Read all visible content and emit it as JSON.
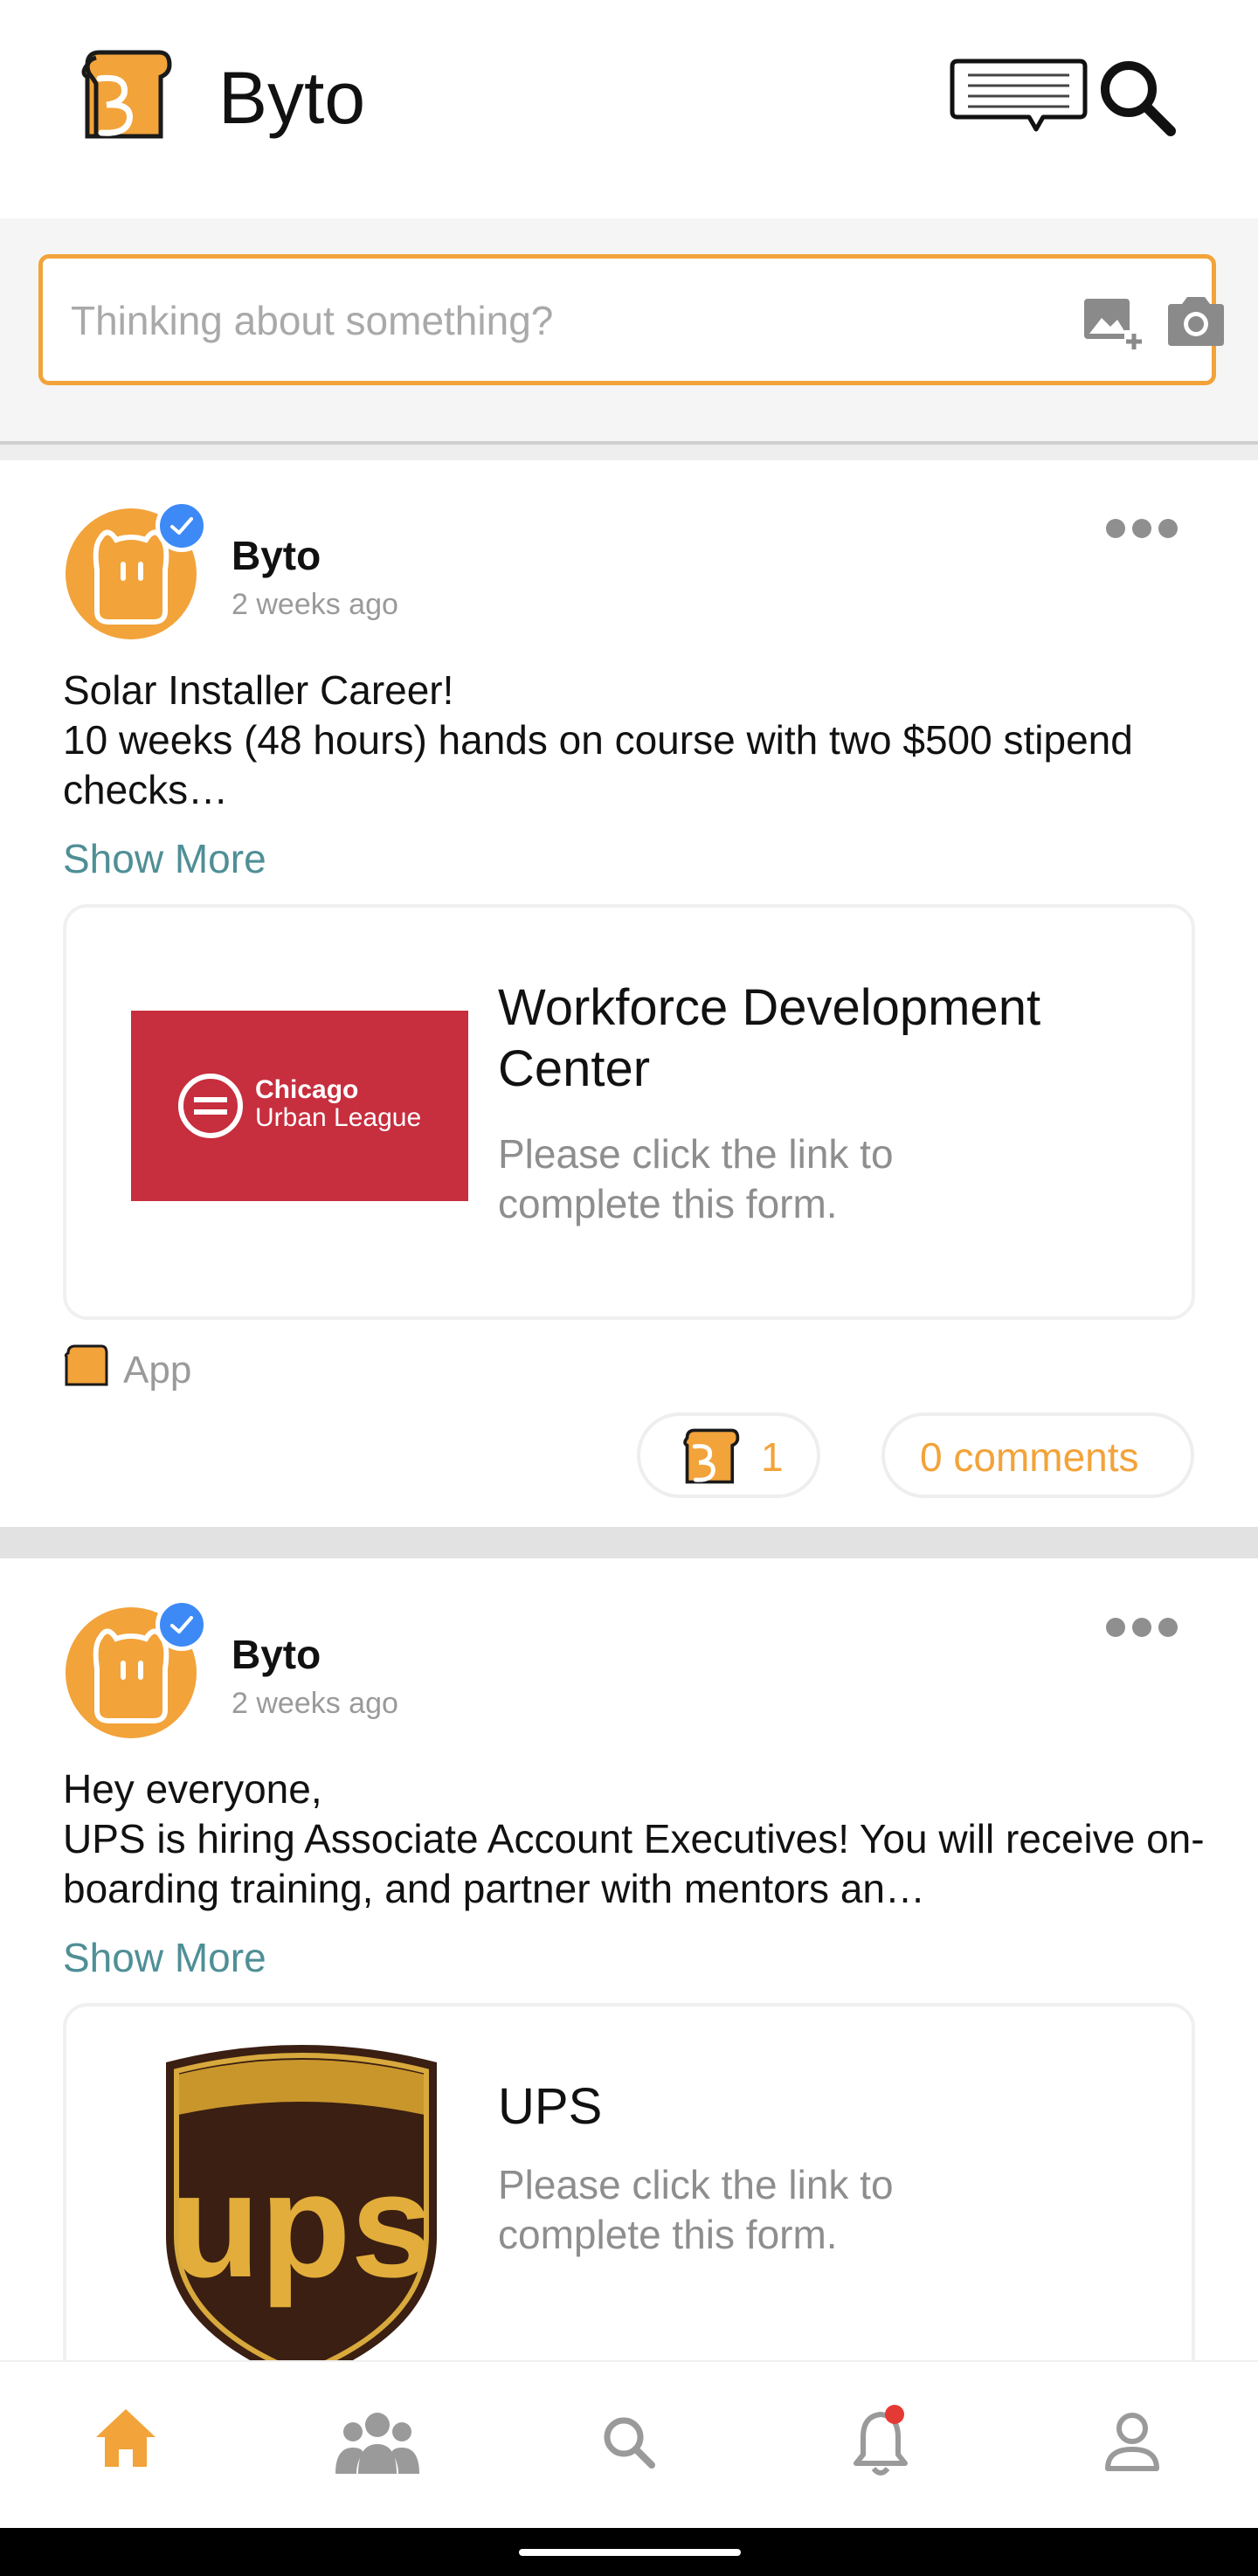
{
  "header": {
    "title": "Byto",
    "logo_icon": "toast-b-logo-icon",
    "messages_icon": "chat-bubble-icon",
    "search_icon": "search-icon"
  },
  "composer": {
    "placeholder": "Thinking about something?",
    "add_image_icon": "add-image-icon",
    "camera_icon": "camera-icon"
  },
  "colors": {
    "accent": "#f2a33a",
    "verified": "#3d8af7",
    "link": "#4f8f96",
    "muted": "#9a9a9a"
  },
  "posts": [
    {
      "author": "Byto",
      "time": "2 weeks ago",
      "text": "Solar Installer Career!\n10 weeks (48 hours) hands on course with two $500 stipend checks…",
      "show_more": "Show More",
      "link_card": {
        "title": "Workforce Development Center",
        "description": "Please click the link to complete this form.",
        "logo_line1": "Chicago",
        "logo_line2": "Urban League"
      },
      "source_label": "App",
      "reaction_count": "1",
      "comments_label": "0 comments"
    },
    {
      "author": "Byto",
      "time": "2 weeks ago",
      "text": "Hey everyone,\nUPS is hiring Associate Account Executives! You will receive on-boarding training, and partner with mentors an…",
      "show_more": "Show More",
      "link_card": {
        "title": "UPS",
        "description": "Please click the link to complete this form.",
        "logo_text": "ups"
      }
    }
  ],
  "bottom_nav": [
    {
      "name": "home",
      "icon": "home-icon",
      "active": true
    },
    {
      "name": "groups",
      "icon": "people-icon",
      "active": false
    },
    {
      "name": "search",
      "icon": "search-icon",
      "active": false
    },
    {
      "name": "notifications",
      "icon": "bell-icon",
      "active": false,
      "has_dot": true
    },
    {
      "name": "profile",
      "icon": "person-icon",
      "active": false
    }
  ]
}
